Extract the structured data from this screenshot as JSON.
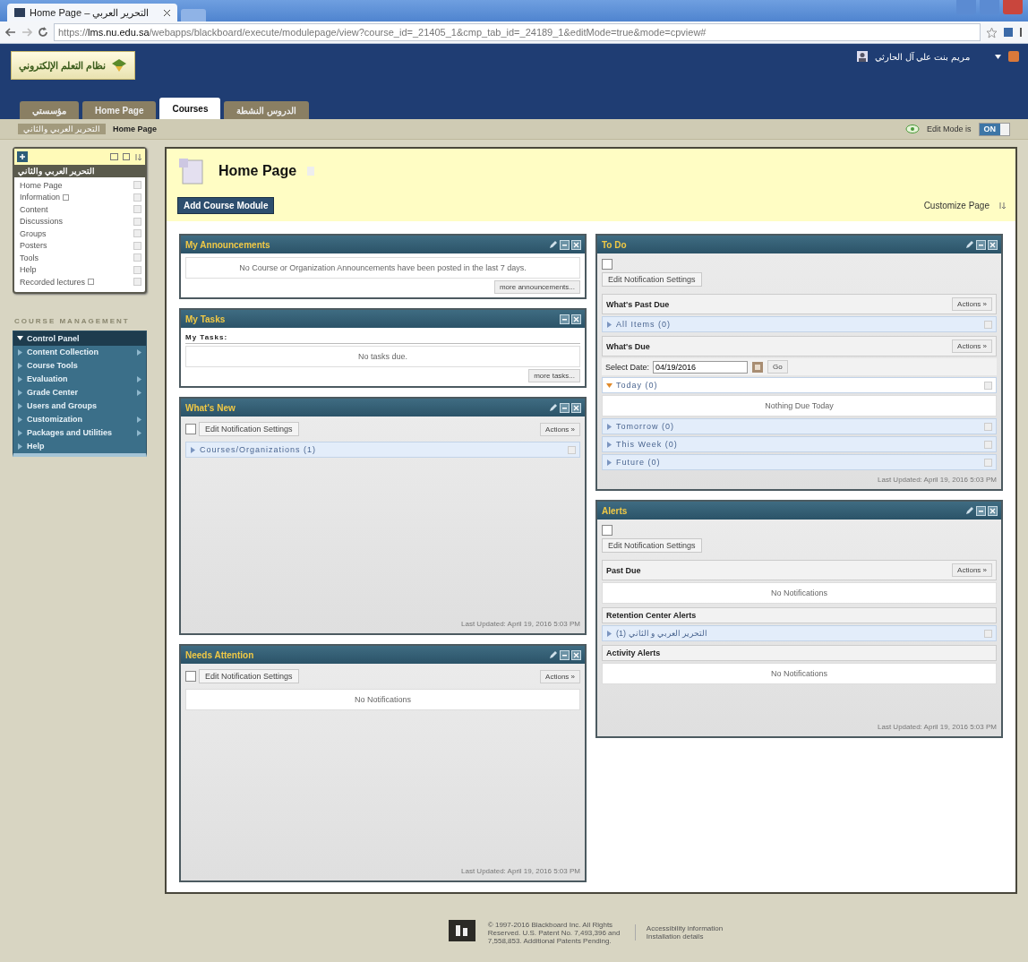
{
  "browser": {
    "tab_title": "Home Page – التحرير العربي",
    "url": "https://**lms.nu.edu.sa**/webapps/blackboard/execute/modulepage/view?course_id=_21405_1&cmp_tab_id=_24189_1&editMode=true&mode=cpview#"
  },
  "header": {
    "logo_text": "نظام التعلم الإلكتروني",
    "user_name": "مريم بنت علي آل الحارثي"
  },
  "nav_tabs": [
    {
      "label": "مؤسستي",
      "selected": false
    },
    {
      "label": "Home Page",
      "selected": false
    },
    {
      "label": "Courses",
      "selected": true
    },
    {
      "label": "الدروس النشطة",
      "selected": false
    }
  ],
  "breadcrumbs": [
    "التحرير العربي والثاني",
    "Home Page"
  ],
  "edit_mode": {
    "label": "Edit Mode is",
    "state_text": "ON",
    "on": true
  },
  "course_menu": {
    "title": "التحرير العربي والثاني",
    "items": [
      {
        "label": "Home Page",
        "linked": false
      },
      {
        "label": "Information",
        "linked": true
      },
      {
        "label": "Content",
        "linked": false
      },
      {
        "label": "Discussions",
        "linked": false
      },
      {
        "label": "Groups",
        "linked": false
      },
      {
        "label": "Posters",
        "linked": false
      },
      {
        "label": "Tools",
        "linked": false
      },
      {
        "label": "Help",
        "linked": false
      },
      {
        "label": "Recorded lectures",
        "linked": true
      }
    ]
  },
  "course_management": {
    "heading": "COURSE MANAGEMENT",
    "items": [
      {
        "label": "Control Panel",
        "expanded": true,
        "submenu": false
      },
      {
        "label": "Content Collection",
        "expanded": false,
        "submenu": true
      },
      {
        "label": "Course Tools",
        "expanded": false,
        "submenu": false
      },
      {
        "label": "Evaluation",
        "expanded": false,
        "submenu": true
      },
      {
        "label": "Grade Center",
        "expanded": false,
        "submenu": true
      },
      {
        "label": "Users and Groups",
        "expanded": false,
        "submenu": false
      },
      {
        "label": "Customization",
        "expanded": false,
        "submenu": true
      },
      {
        "label": "Packages and Utilities",
        "expanded": false,
        "submenu": true
      },
      {
        "label": "Help",
        "expanded": false,
        "submenu": false
      }
    ]
  },
  "page": {
    "title": "Home Page",
    "add_button": "Add Course Module",
    "customize": "Customize Page"
  },
  "left_modules": [
    {
      "title": "My Announcements",
      "editable": true,
      "blocks": [
        {
          "kind": "message",
          "text": "No Course or Organization Announcements have been posted in the last 7 days."
        },
        {
          "kind": "more_button",
          "label": "more announcements..."
        }
      ]
    },
    {
      "title": "My Tasks",
      "editable": false,
      "blocks": [
        {
          "kind": "subheading",
          "text": "My Tasks:"
        },
        {
          "kind": "message",
          "text": "No tasks due."
        },
        {
          "kind": "more_button",
          "label": "more tasks..."
        }
      ]
    },
    {
      "title": "What's New",
      "editable": true,
      "updated": "Last Updated: April 19, 2016 5:03 PM",
      "blocks": [
        {
          "kind": "toolbar_inline",
          "edit_label": "Edit Notification Settings",
          "actions": "Actions »"
        },
        {
          "kind": "group_row",
          "text": "Courses/Organizations (1)",
          "expanded": false
        }
      ]
    },
    {
      "title": "Needs Attention",
      "editable": true,
      "updated": "Last Updated: April 19, 2016 5:03 PM",
      "blocks": [
        {
          "kind": "toolbar_inline",
          "edit_label": "Edit Notification Settings",
          "actions": "Actions »"
        },
        {
          "kind": "message",
          "text": "No Notifications"
        }
      ]
    }
  ],
  "right_modules": [
    {
      "title": "To Do",
      "editable": true,
      "updated": "Last Updated: April 19, 2016 5:03 PM",
      "blocks": [
        {
          "kind": "toolbar_stacked",
          "edit_label": "Edit Notification Settings"
        },
        {
          "kind": "section_header",
          "text": "What's Past Due",
          "actions": "Actions »"
        },
        {
          "kind": "group_row",
          "text": "All Items (0)",
          "expanded": false
        },
        {
          "kind": "section_header",
          "text": "What's Due",
          "actions": "Actions »"
        },
        {
          "kind": "date_picker",
          "label": "Select Date:",
          "value": "04/19/2016",
          "button": "Go"
        },
        {
          "kind": "group_row",
          "text": "Today (0)",
          "expanded": true
        },
        {
          "kind": "message",
          "text": "Nothing Due Today"
        },
        {
          "kind": "group_row",
          "text": "Tomorrow (0)",
          "expanded": false
        },
        {
          "kind": "group_row",
          "text": "This Week (0)",
          "expanded": false
        },
        {
          "kind": "group_row",
          "text": "Future (0)",
          "expanded": false
        }
      ]
    },
    {
      "title": "Alerts",
      "editable": true,
      "updated": "Last Updated: April 19, 2016 5:03 PM",
      "blocks": [
        {
          "kind": "toolbar_stacked",
          "edit_label": "Edit Notification Settings"
        },
        {
          "kind": "section_header",
          "text": "Past Due",
          "actions": "Actions »"
        },
        {
          "kind": "message",
          "text": "No Notifications"
        },
        {
          "kind": "section_header",
          "text": "Retention Center Alerts"
        },
        {
          "kind": "group_row",
          "text": "التحرير العربي و الثاني (1)",
          "expanded": false
        },
        {
          "kind": "section_header",
          "text": "Activity Alerts"
        },
        {
          "kind": "message",
          "text": "No Notifications"
        }
      ]
    }
  ],
  "footer": {
    "copyright": "© 1997-2016 Blackboard Inc. All Rights Reserved. U.S. Patent No. 7,493,396 and 7,558,853. Additional Patents Pending.",
    "links": [
      "Accessibility information",
      "Installation details"
    ]
  }
}
